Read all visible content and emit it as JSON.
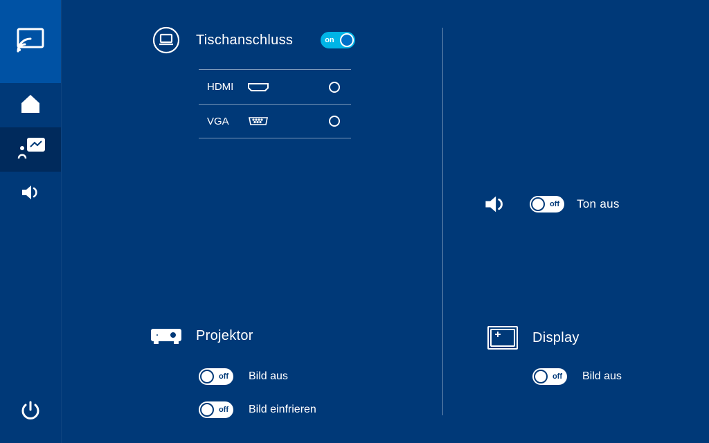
{
  "sidebar": {
    "cast_icon": "cast-icon",
    "home_icon": "home-icon",
    "present_icon": "present-icon",
    "sound_icon": "speaker-icon",
    "power_icon": "power-icon"
  },
  "tisch": {
    "label": "Tischanschluss",
    "toggle": {
      "state": "on",
      "text": "on"
    },
    "connections": [
      {
        "label": "HDMI",
        "icon": "hdmi-port-icon",
        "selected": false
      },
      {
        "label": "VGA",
        "icon": "vga-port-icon",
        "selected": false
      }
    ]
  },
  "sound": {
    "label": "Ton aus",
    "toggle": {
      "state": "off",
      "text": "off"
    }
  },
  "projector": {
    "label": "Projektor",
    "controls": [
      {
        "label": "Bild aus",
        "toggle": {
          "state": "off",
          "text": "off"
        }
      },
      {
        "label": "Bild einfrieren",
        "toggle": {
          "state": "off",
          "text": "off"
        }
      }
    ]
  },
  "display": {
    "label": "Display",
    "controls": [
      {
        "label": "Bild aus",
        "toggle": {
          "state": "off",
          "text": "off"
        }
      }
    ]
  }
}
